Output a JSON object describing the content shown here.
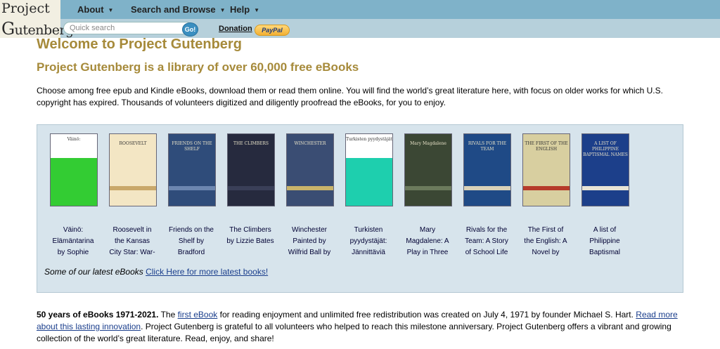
{
  "logo": {
    "line1": "Project",
    "line2_cap": "G",
    "line2_rest": "utenberg"
  },
  "nav": {
    "about": "About",
    "search_browse": "Search and Browse",
    "help": "Help"
  },
  "search": {
    "placeholder": "Quick search",
    "go_label": "Go!"
  },
  "donation": "Donation",
  "paypal": "PayPal",
  "headline": "Welcome to Project Gutenberg",
  "subheadline": "Project Gutenberg is a library of over 60,000 free eBooks",
  "intro": "Choose among free epub and Kindle eBooks, download them or read them online. You will find the world’s great literature here, with focus on older works for which U.S. copyright has expired. Thousands of volunteers digitized and diligently proofread the eBooks, for you to enjoy.",
  "books": [
    {
      "title_lines": [
        "Väinö:",
        "Elämäntarina",
        "by Sophie"
      ],
      "cover": {
        "bg": "#ffffff",
        "accent": "#33cc33",
        "text": "Väinö:"
      }
    },
    {
      "title_lines": [
        "Roosevelt in",
        "the Kansas",
        "City Star: War-"
      ],
      "cover": {
        "bg": "#f3e6c4",
        "accent": "#c9a86a",
        "text": "ROOSEVELT"
      }
    },
    {
      "title_lines": [
        "Friends on the",
        "Shelf by",
        "Bradford"
      ],
      "cover": {
        "bg": "#2f4c7a",
        "accent": "#6c86b0",
        "text": "FRIENDS ON THE SHELF"
      }
    },
    {
      "title_lines": [
        "The Climbers",
        "by Lizzie Bates"
      ],
      "cover": {
        "bg": "#262a3e",
        "accent": "#3a3f58",
        "text": "THE CLIMBERS"
      }
    },
    {
      "title_lines": [
        "Winchester",
        "Painted by",
        "Wilfrid Ball by"
      ],
      "cover": {
        "bg": "#3a4d73",
        "accent": "#c9b36a",
        "text": "WINCHESTER"
      }
    },
    {
      "title_lines": [
        "Turkisten",
        "pyydystäjät:",
        "Jännittäviä"
      ],
      "cover": {
        "bg": "#ffffff",
        "accent": "#1ecfae",
        "text": "Turkisten pyydystäjät"
      }
    },
    {
      "title_lines": [
        "Mary",
        "Magdalene: A",
        "Play in Three"
      ],
      "cover": {
        "bg": "#3b4734",
        "accent": "#6b7a5c",
        "text": "Mary Magdalene"
      }
    },
    {
      "title_lines": [
        "Rivals for the",
        "Team: A Story",
        "of School Life"
      ],
      "cover": {
        "bg": "#1f4a86",
        "accent": "#d9d1b8",
        "text": "RIVALS FOR THE TEAM"
      }
    },
    {
      "title_lines": [
        "The First of",
        "the English: A",
        "Novel by"
      ],
      "cover": {
        "bg": "#d8cfa0",
        "accent": "#b63b2a",
        "text": "THE FIRST OF THE ENGLISH"
      }
    },
    {
      "title_lines": [
        "A list of",
        "Philippine",
        "Baptismal"
      ],
      "cover": {
        "bg": "#1c3f8a",
        "accent": "#e8e4d6",
        "text": "A LIST OF PHILIPPINE BAPTISMAL NAMES"
      }
    }
  ],
  "latest": {
    "prefix": "Some of our latest eBooks",
    "link": "Click Here for more latest books!"
  },
  "anniversary": {
    "bold": "50 years of eBooks 1971-2021.",
    "text1": " The ",
    "link1": "first eBook",
    "text2": " for reading enjoyment and unlimited free redistribution was created on July 4, 1971 by founder Michael S. Hart. ",
    "link2": "Read more about this lasting innovation",
    "text3": ". Project Gutenberg is grateful to all volunteers who helped to reach this milestone anniversary. Project Gutenberg offers a vibrant and growing collection of the world’s great literature. Read, enjoy, and share!"
  },
  "colors": {
    "topbar": "#7fb2c9",
    "subbar": "#b6d0db",
    "heading": "#a68a3a",
    "link": "#1a3e8c",
    "panel": "#d7e4ec"
  }
}
